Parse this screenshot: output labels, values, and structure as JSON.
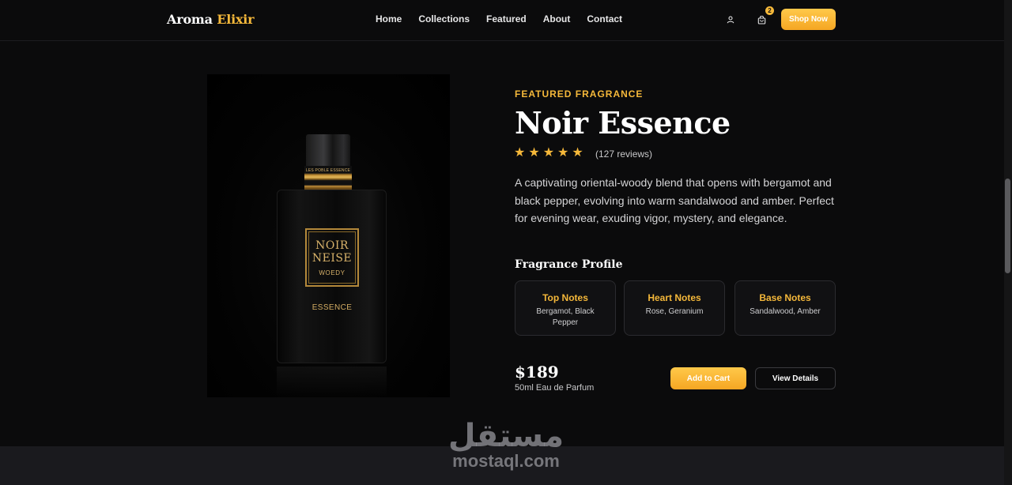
{
  "header": {
    "logo_main": "Aroma",
    "logo_accent": "Elixir",
    "nav": [
      "Home",
      "Collections",
      "Featured",
      "About",
      "Contact"
    ],
    "cart_count": "2",
    "shop_button": "Shop Now"
  },
  "product": {
    "image_label": {
      "collar_text": "LES POBLE ESSENCE",
      "line1": "NOIR",
      "line2": "NEISE",
      "small": "WOEDY",
      "bottom": "ESSENCE"
    },
    "eyebrow": "FEATURED FRAGRANCE",
    "title": "Noir Essence",
    "rating": 5,
    "reviews": "(127 reviews)",
    "description": "A captivating oriental-woody blend that opens with bergamot and black pepper, evolving into warm sandalwood and amber. Perfect for evening wear, exuding vigor, mystery, and elegance.",
    "profile_title": "Fragrance Profile",
    "notes": [
      {
        "title": "Top Notes",
        "value": "Bergamot, Black Pepper"
      },
      {
        "title": "Heart Notes",
        "value": "Rose, Geranium"
      },
      {
        "title": "Base Notes",
        "value": "Sandalwood, Amber"
      }
    ],
    "price": "$189",
    "volume": "50ml Eau de Parfum",
    "add_to_cart": "Add to Cart",
    "view_details": "View Details"
  },
  "watermark": {
    "arabic": "مستقل",
    "latin": "mostaql.com"
  },
  "colors": {
    "accent": "#f5b83a",
    "background": "#0b0b0c",
    "card_border": "#2b2b2f"
  }
}
